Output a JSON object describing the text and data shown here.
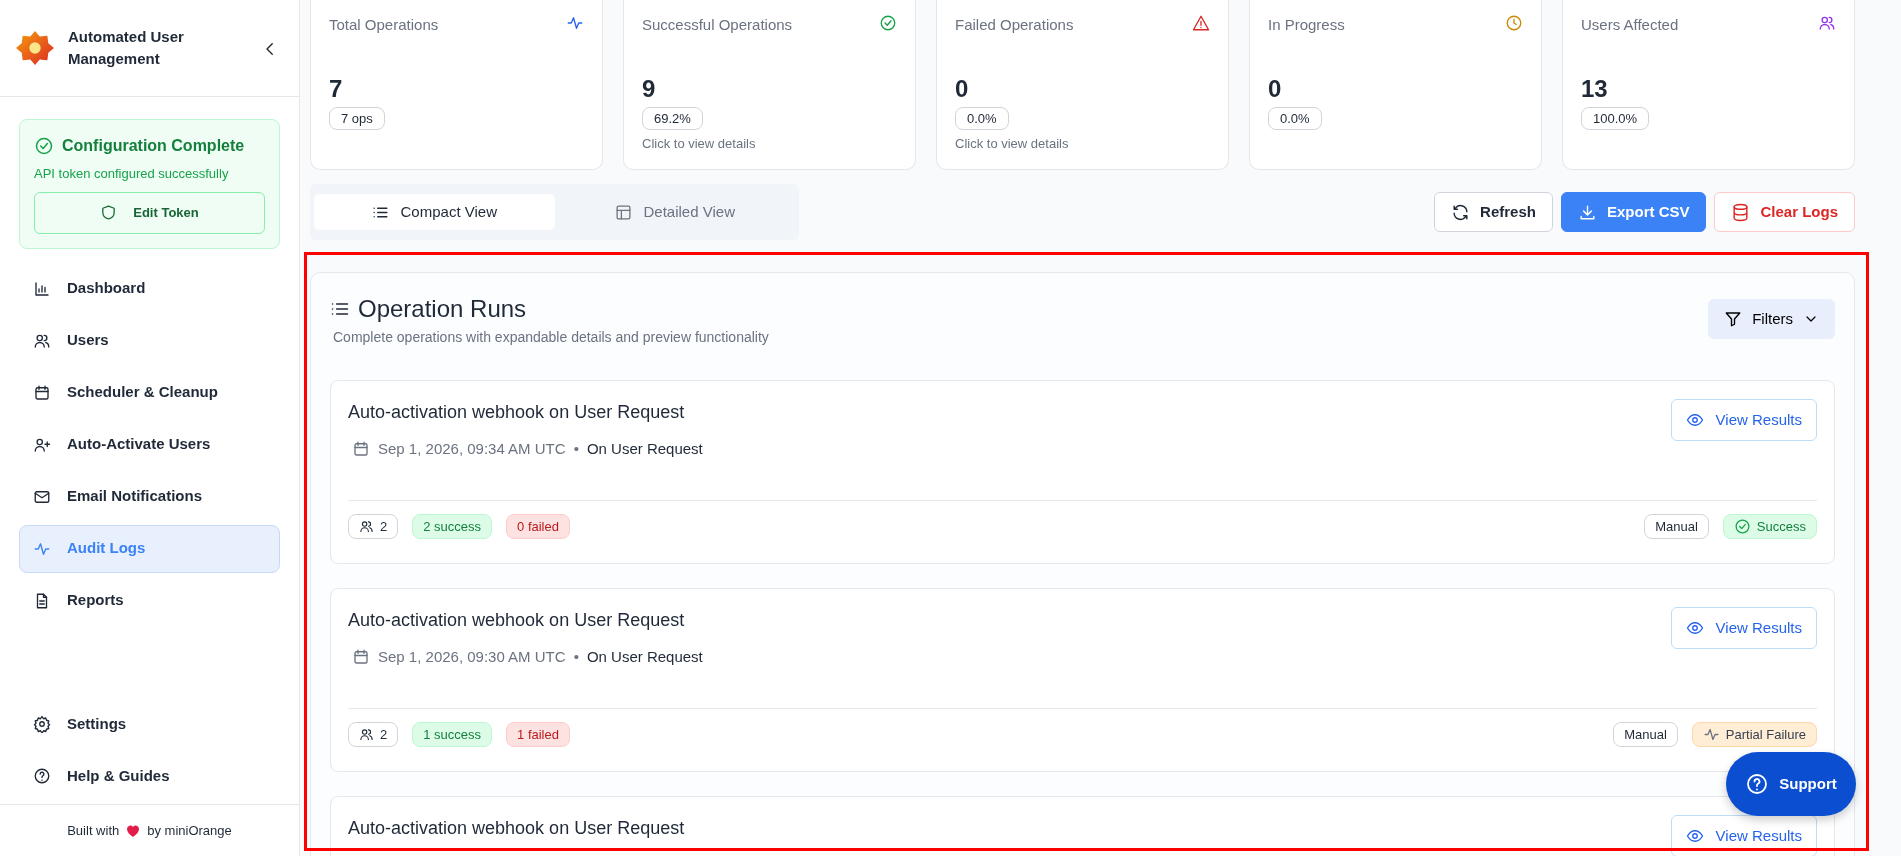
{
  "sidebar": {
    "app_title": "Automated User Management",
    "config": {
      "title": "Configuration Complete",
      "message": "API token configured successfully",
      "button": "Edit Token"
    },
    "nav": [
      {
        "label": "Dashboard",
        "selected": false
      },
      {
        "label": "Users",
        "selected": false
      },
      {
        "label": "Scheduler & Cleanup",
        "selected": false
      },
      {
        "label": "Auto-Activate Users",
        "selected": false
      },
      {
        "label": "Email Notifications",
        "selected": false
      },
      {
        "label": "Audit Logs",
        "selected": true
      },
      {
        "label": "Reports",
        "selected": false
      }
    ],
    "bottom_nav": [
      {
        "label": "Settings"
      },
      {
        "label": "Help & Guides"
      }
    ],
    "footer": {
      "before": "Built with",
      "after": "by miniOrange"
    }
  },
  "stats": [
    {
      "label": "Total Operations",
      "value": "7",
      "badge": "7 ops",
      "color": "#2563eb"
    },
    {
      "label": "Successful Operations",
      "value": "9",
      "badge": "69.2%",
      "note": "Click to view details",
      "color": "#16a34a"
    },
    {
      "label": "Failed Operations",
      "value": "0",
      "badge": "0.0%",
      "note": "Click to view details",
      "color": "#dc2626"
    },
    {
      "label": "In Progress",
      "value": "0",
      "badge": "0.0%",
      "color": "#ca8a04"
    },
    {
      "label": "Users Affected",
      "value": "13",
      "badge": "100.0%",
      "color": "#9333ea"
    }
  ],
  "view_tabs": [
    {
      "label": "Compact View",
      "selected": true
    },
    {
      "label": "Detailed View",
      "selected": false
    }
  ],
  "actions": [
    {
      "label": "Refresh",
      "kind": "outline"
    },
    {
      "label": "Export CSV",
      "kind": "primary"
    },
    {
      "label": "Clear Logs",
      "kind": "danger"
    }
  ],
  "panel": {
    "title": "Operation Runs",
    "subtitle": "Complete operations with expandable details and preview functionality",
    "filter_button": "Filters"
  },
  "runs": [
    {
      "title": "Auto-activation webhook on User Request",
      "date": "Sep 1, 2026, 09:34 AM UTC",
      "separator": "•",
      "trigger": "On User Request",
      "users": "2",
      "success": "2 success",
      "failed": "0 failed",
      "type": "Manual",
      "status": {
        "label": "Success",
        "kind": "success"
      },
      "button": "View Results"
    },
    {
      "title": "Auto-activation webhook on User Request",
      "date": "Sep 1, 2026, 09:30 AM UTC",
      "separator": "•",
      "trigger": "On User Request",
      "users": "2",
      "success": "1 success",
      "failed": "1 failed",
      "type": "Manual",
      "status": {
        "label": "Partial Failure",
        "kind": "partial"
      },
      "button": "View Results"
    },
    {
      "title": "Auto-activation webhook on User Request",
      "button": "View Results"
    }
  ],
  "support": "Support"
}
